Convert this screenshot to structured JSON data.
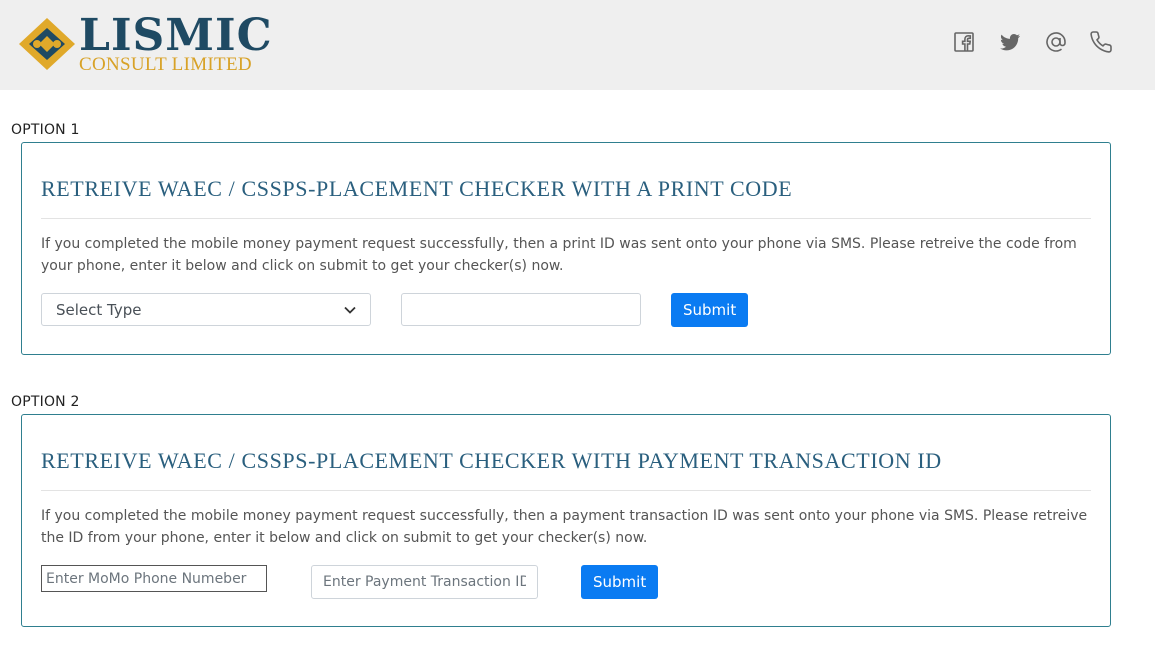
{
  "header": {
    "logo": {
      "word": "LISMIC",
      "sub": "CONSULT LIMITED"
    },
    "social": [
      {
        "name": "facebook-icon"
      },
      {
        "name": "twitter-icon"
      },
      {
        "name": "email-at-icon"
      },
      {
        "name": "phone-icon"
      }
    ]
  },
  "option1": {
    "label": "OPTION 1",
    "title": "RETREIVE WAEC / CSSPS-PLACEMENT CHECKER WITH A PRINT CODE",
    "description": "If you completed the mobile money payment request successfully, then a print ID was sent onto your phone via SMS. Please retreive the code from your phone, enter it below and click on submit to get your checker(s) now.",
    "select_value": "Select Type",
    "code_value": "",
    "submit_label": "Submit"
  },
  "option2": {
    "label": "OPTION 2",
    "title": "RETREIVE WAEC / CSSPS-PLACEMENT CHECKER WITH PAYMENT TRANSACTION ID",
    "description": "If you completed the mobile money payment request successfully, then a payment transaction ID was sent onto your phone via SMS. Please retreive the ID from your phone, enter it below and click on submit to get your checker(s) now.",
    "phone_placeholder": "Enter MoMo Phone Numeber",
    "txn_placeholder": "Enter Payment Transaction ID",
    "submit_label": "Submit"
  },
  "colors": {
    "header_bg": "#efefef",
    "card_border": "#2f7f8f",
    "title": "#2a5f7e",
    "button": "#0a7bf2",
    "logo_word": "#1f4a63",
    "logo_sub": "#d8a227"
  }
}
